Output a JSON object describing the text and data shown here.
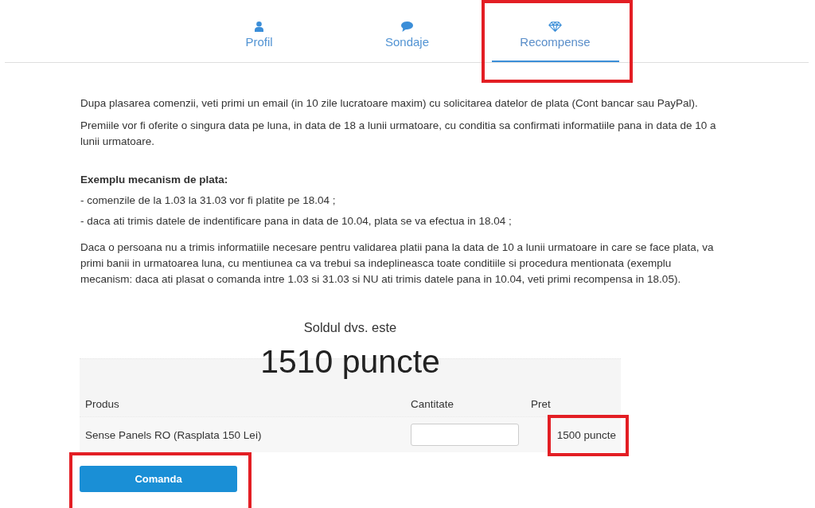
{
  "tabs": [
    {
      "label": "Profil",
      "selected": false,
      "highlighted": false
    },
    {
      "label": "Sondaje",
      "selected": false,
      "highlighted": false
    },
    {
      "label": "Recompense",
      "selected": true,
      "highlighted": true
    }
  ],
  "intro_paragraphs": [
    "Dupa plasarea comenzii, veti primi un email (in 10 zile lucratoare maxim) cu solicitarea datelor de plata (Cont bancar sau PayPal).",
    "Premiile vor fi oferite o singura data pe luna, in data de 18 a lunii urmatoare, cu conditia sa confirmati informatiile pana in data de 10 a lunii urmatoare."
  ],
  "example": {
    "heading": "Exemplu mecanism de plata:",
    "items": [
      "- comenzile de la 1.03 la 31.03 vor fi platite pe 18.04 ;",
      "- daca ati trimis datele de indentificare pana in data de 10.04, plata se va efectua in 18.04 ;"
    ],
    "note": "Daca o persoana nu a trimis informatiile necesare pentru validarea platii pana la data de 10 a lunii urmatoare in care se face plata, va primi banii in urmatoarea luna, cu mentiunea ca va trebui sa indeplineasca toate conditiile si procedura mentionata (exemplu mecanism: daca ati plasat o comanda intre 1.03 si 31.03 si NU ati trimis datele pana in 10.04, veti primi recompensa in 18.05)."
  },
  "balance": {
    "label": "Soldul dvs. este",
    "amount": "1510 puncte"
  },
  "table": {
    "columns": [
      "Produs",
      "Cantitate",
      "Pret"
    ],
    "rows": [
      {
        "product": "Sense Panels RO (Rasplata 150 Lei)",
        "price": {
          "text": "1500 puncte",
          "highlighted": true
        }
      }
    ]
  },
  "order_button": {
    "label": "Comanda",
    "highlighted": true
  }
}
